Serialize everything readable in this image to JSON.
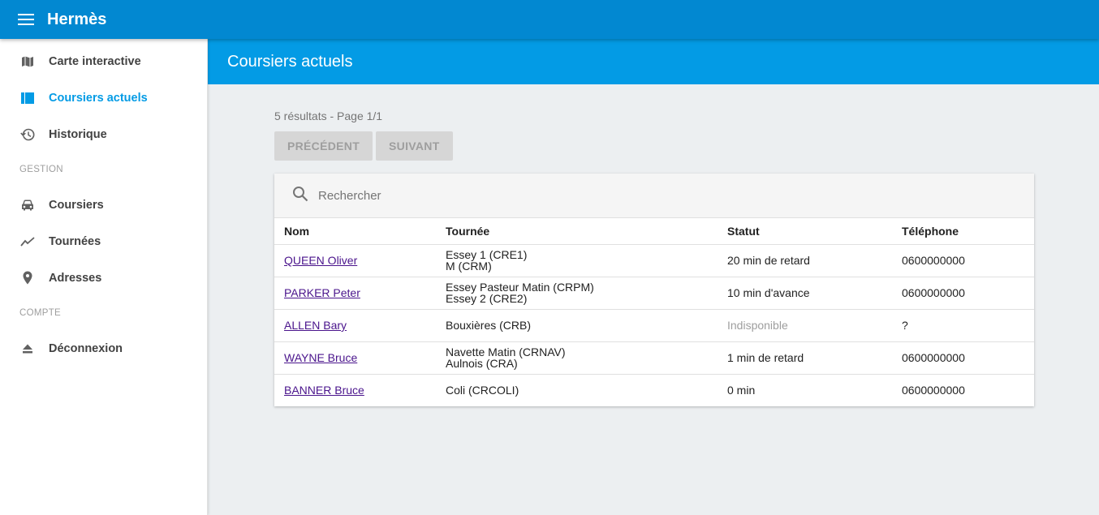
{
  "app": {
    "title": "Hermès"
  },
  "sidebar": {
    "items": [
      {
        "label": "Carte interactive",
        "icon": "map-icon",
        "active": false
      },
      {
        "label": "Coursiers actuels",
        "icon": "view-list-icon",
        "active": true
      },
      {
        "label": "Historique",
        "icon": "history-icon",
        "active": false
      }
    ],
    "sections": [
      {
        "header": "GESTION",
        "items": [
          {
            "label": "Coursiers",
            "icon": "car-icon"
          },
          {
            "label": "Tournées",
            "icon": "trending-icon"
          },
          {
            "label": "Adresses",
            "icon": "place-icon"
          }
        ]
      },
      {
        "header": "COMPTE",
        "items": [
          {
            "label": "Déconnexion",
            "icon": "eject-icon"
          }
        ]
      }
    ]
  },
  "header": {
    "title": "Coursiers actuels"
  },
  "results": {
    "info": "5 résultats - Page 1/1",
    "prev_label": "PRÉCÉDENT",
    "next_label": "SUIVANT"
  },
  "search": {
    "placeholder": "Rechercher"
  },
  "table": {
    "columns": [
      "Nom",
      "Tournée",
      "Statut",
      "Téléphone"
    ],
    "rows": [
      {
        "name": "QUEEN Oliver",
        "tours": [
          "Essey 1 (CRE1)",
          "M (CRM)"
        ],
        "status": "20 min de retard",
        "phone": "0600000000"
      },
      {
        "name": "PARKER Peter",
        "tours": [
          "Essey Pasteur Matin (CRPM)",
          "Essey 2 (CRE2)"
        ],
        "status": "10 min d'avance",
        "phone": "0600000000"
      },
      {
        "name": "ALLEN Bary",
        "tours": [
          "Bouxières (CRB)"
        ],
        "status": "Indisponible",
        "phone": "?"
      },
      {
        "name": "WAYNE Bruce",
        "tours": [
          "Navette Matin (CRNAV)",
          "Aulnois (CRA)"
        ],
        "status": "1 min de retard",
        "phone": "0600000000"
      },
      {
        "name": "BANNER Bruce",
        "tours": [
          "Coli (CRCOLI)"
        ],
        "status": "0 min",
        "phone": "0600000000"
      }
    ]
  },
  "colors": {
    "topbar": "#0288d1",
    "header": "#039be5",
    "active": "#039be5",
    "link": "#4a148c"
  }
}
